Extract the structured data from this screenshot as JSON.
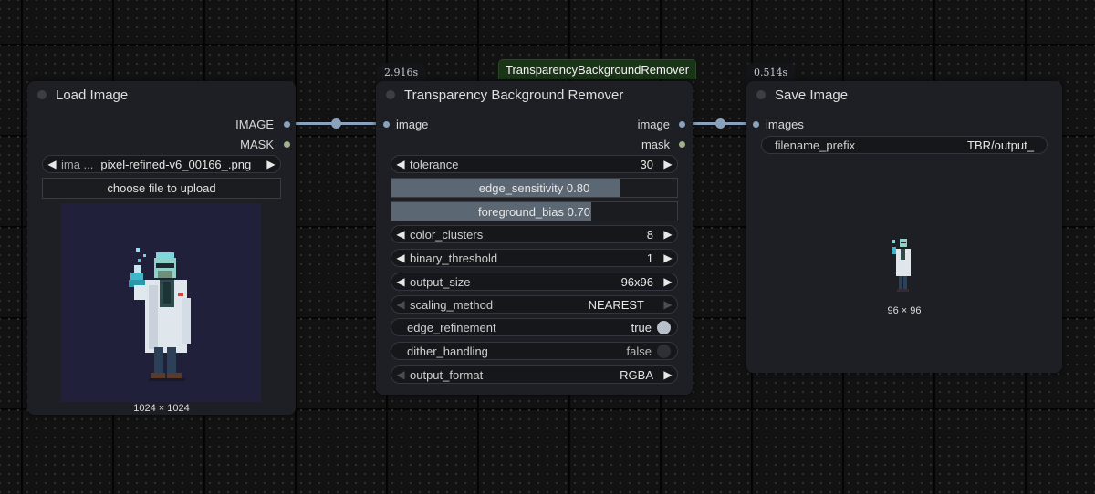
{
  "nodes": {
    "load": {
      "title": "Load Image",
      "outputs": [
        "IMAGE",
        "MASK"
      ],
      "file_label": "ima ...",
      "file_value": "pixel-refined-v6_00166_.png",
      "upload_label": "choose file to upload",
      "dimensions": "1024 × 1024"
    },
    "remover": {
      "title": "Transparency Background Remover",
      "timing": "2.916s",
      "badge": "TransparencyBackgroundRemover",
      "input": "image",
      "outputs": [
        "image",
        "mask"
      ],
      "widgets": {
        "tolerance": {
          "label": "tolerance",
          "value": "30"
        },
        "edge_sensitivity": {
          "label": "edge_sensitivity",
          "value": "0.80",
          "level": 0.8
        },
        "foreground_bias": {
          "label": "foreground_bias",
          "value": "0.70",
          "level": 0.7
        },
        "color_clusters": {
          "label": "color_clusters",
          "value": "8"
        },
        "binary_threshold": {
          "label": "binary_threshold",
          "value": "1"
        },
        "output_size": {
          "label": "output_size",
          "value": "96x96"
        },
        "scaling_method": {
          "label": "scaling_method",
          "value": "NEAREST"
        },
        "edge_refinement": {
          "label": "edge_refinement",
          "value": "true"
        },
        "dither_handling": {
          "label": "dither_handling",
          "value": "false"
        },
        "output_format": {
          "label": "output_format",
          "value": "RGBA"
        }
      }
    },
    "save": {
      "title": "Save Image",
      "timing": "0.514s",
      "input": "images",
      "filename_label": "filename_prefix",
      "filename_value": "TBR/output_",
      "dimensions": "96 × 96"
    }
  },
  "colors": {
    "image_slot": "#8ba2bd",
    "mask_slot": "#9fb08a",
    "canvas": "#121212",
    "node_body": "#1e1f24"
  },
  "icons": {
    "left_arrow": "◀",
    "right_arrow": "▶"
  }
}
